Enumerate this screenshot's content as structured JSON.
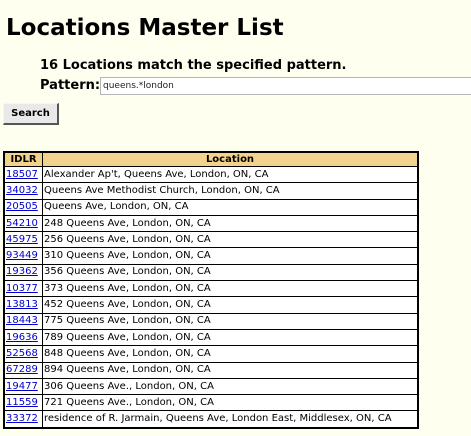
{
  "page": {
    "title": "Locations Master List",
    "match_summary": "16 Locations match the specified pattern."
  },
  "search": {
    "pattern_label": "Pattern:",
    "pattern_value": "queens.*london",
    "button_label": "Search"
  },
  "table": {
    "columns": [
      "IDLR",
      "Location"
    ],
    "rows": [
      {
        "idlr": "18507",
        "location": "Alexander Ap't, Queens Ave, London, ON, CA"
      },
      {
        "idlr": "34032",
        "location": "Queens Ave Methodist Church, London, ON, CA"
      },
      {
        "idlr": "20505",
        "location": "Queens Ave, London, ON, CA"
      },
      {
        "idlr": "54210",
        "location": "248 Queens Ave, London, ON, CA"
      },
      {
        "idlr": "45975",
        "location": "256 Queens Ave, London, ON, CA"
      },
      {
        "idlr": "93449",
        "location": "310 Queens Ave, London, ON, CA"
      },
      {
        "idlr": "19362",
        "location": "356 Queens Ave, London, ON, CA"
      },
      {
        "idlr": "10377",
        "location": "373 Queens Ave, London, ON, CA"
      },
      {
        "idlr": "13813",
        "location": "452 Queens Ave, London, ON, CA"
      },
      {
        "idlr": "18443",
        "location": "775 Queens Ave, London, ON, CA"
      },
      {
        "idlr": "19636",
        "location": "789 Queens Ave, London, ON, CA"
      },
      {
        "idlr": "52568",
        "location": "848 Queens Ave, London, ON, CA"
      },
      {
        "idlr": "67289",
        "location": "894 Queens Ave, London, ON, CA"
      },
      {
        "idlr": "19477",
        "location": "306 Queens Ave., London, ON, CA"
      },
      {
        "idlr": "11559",
        "location": "721 Queens Ave., London, ON, CA"
      },
      {
        "idlr": "33372",
        "location": "residence of R. Jarmain, Queens Ave, London East, Middlesex, ON, CA"
      }
    ]
  },
  "colors": {
    "page_background": "#fffff0",
    "header_background": "#f3d38b",
    "link": "#0000cc"
  }
}
